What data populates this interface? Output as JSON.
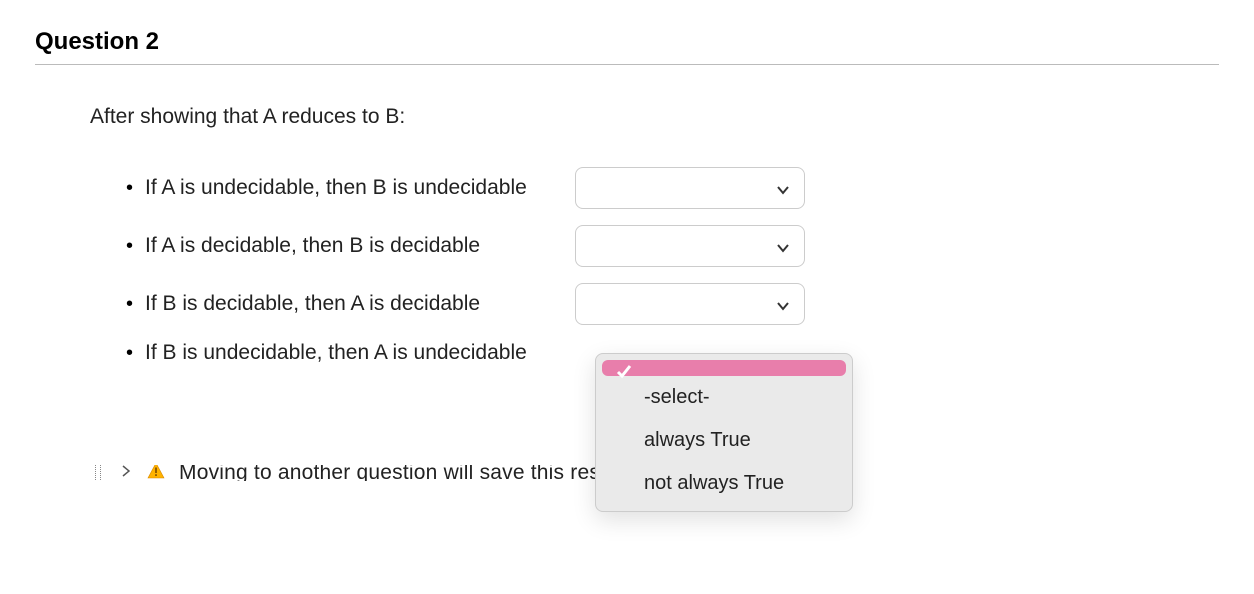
{
  "question": {
    "header": "Question 2",
    "prompt": "After showing that A reduces to B:",
    "statements": [
      {
        "text": "If A is undecidable, then B is undecidable"
      },
      {
        "text": "If A is decidable, then B is decidable"
      },
      {
        "text": "If B is decidable, then A is decidable"
      },
      {
        "text": "If B is undecidable, then A is undecidable"
      }
    ]
  },
  "dropdown": {
    "options": [
      {
        "label": "",
        "selected": true
      },
      {
        "label": "-select-",
        "selected": false
      },
      {
        "label": "always True",
        "selected": false
      },
      {
        "label": "not always True",
        "selected": false
      }
    ]
  },
  "warning_text_bottom": "Moving to another question will save this response."
}
